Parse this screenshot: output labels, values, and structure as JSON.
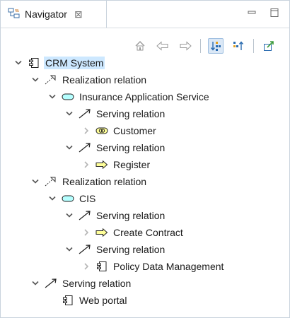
{
  "view": {
    "tab_label": "Navigator",
    "close_glyph": "⊠"
  },
  "toolbar": {
    "buttons": [
      {
        "name": "home-icon"
      },
      {
        "name": "back-arrow-icon"
      },
      {
        "name": "forward-arrow-icon"
      },
      {
        "name": "show-target-relations-icon",
        "pressed": true
      },
      {
        "name": "show-source-relations-icon"
      },
      {
        "name": "pin-view-icon"
      }
    ]
  },
  "tree": [
    {
      "label": "CRM System",
      "level": 0,
      "expander": "expanded",
      "icon": "application-component-icon",
      "selected": true
    },
    {
      "label": "Realization relation",
      "level": 1,
      "expander": "expanded",
      "icon": "realization-relation-icon"
    },
    {
      "label": "Insurance Application Service",
      "level": 2,
      "expander": "expanded",
      "icon": "application-service-icon"
    },
    {
      "label": "Serving relation",
      "level": 3,
      "expander": "expanded",
      "icon": "serving-relation-icon"
    },
    {
      "label": "Customer",
      "level": 4,
      "expander": "collapsed",
      "icon": "business-service-icon"
    },
    {
      "label": "Serving relation",
      "level": 3,
      "expander": "expanded",
      "icon": "serving-relation-icon"
    },
    {
      "label": "Register",
      "level": 4,
      "expander": "collapsed",
      "icon": "business-process-icon"
    },
    {
      "label": "Realization relation",
      "level": 1,
      "expander": "expanded",
      "icon": "realization-relation-icon"
    },
    {
      "label": "CIS",
      "level": 2,
      "expander": "expanded",
      "icon": "application-service-icon"
    },
    {
      "label": "Serving relation",
      "level": 3,
      "expander": "expanded",
      "icon": "serving-relation-icon"
    },
    {
      "label": "Create Contract",
      "level": 4,
      "expander": "collapsed",
      "icon": "business-process-icon"
    },
    {
      "label": "Serving relation",
      "level": 3,
      "expander": "expanded",
      "icon": "serving-relation-icon"
    },
    {
      "label": "Policy Data Management",
      "level": 4,
      "expander": "collapsed",
      "icon": "application-component-icon"
    },
    {
      "label": "Serving relation",
      "level": 1,
      "expander": "expanded",
      "icon": "serving-relation-icon"
    },
    {
      "label": "Web portal",
      "level": 2,
      "expander": "none",
      "icon": "application-component-icon"
    }
  ],
  "colors": {
    "selection": "#cde8ff",
    "application_fill": "#b5ffff",
    "business_fill": "#ffff99",
    "chevron": "#555555",
    "chevron_collapsed": "#b5b5b5"
  }
}
